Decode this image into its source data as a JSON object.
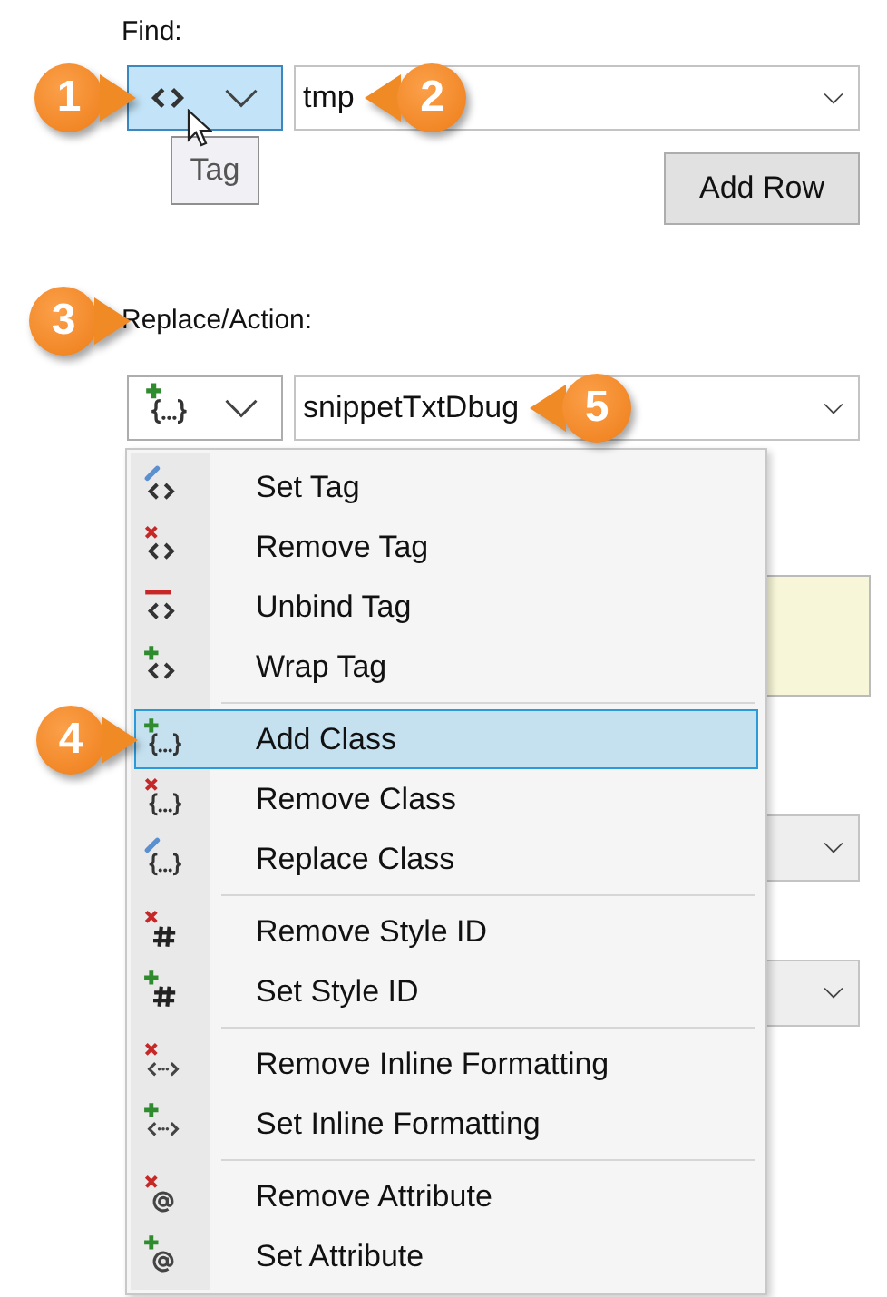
{
  "find": {
    "label": "Find:",
    "type_button": {
      "kind": "tag",
      "hovered": true,
      "tooltip": "Tag",
      "callout": {
        "number": "1",
        "points_left": false
      }
    },
    "value": "tmp",
    "value_callout": {
      "number": "2",
      "points_left": true
    }
  },
  "add_row_button": "Add Row",
  "replace": {
    "label": "Replace/Action:",
    "label_callout": {
      "number": "3",
      "points_left": false
    },
    "type_button": {
      "kind": "add-class",
      "hovered": false
    },
    "value": "snippetTxtDbug",
    "value_callout": {
      "number": "5",
      "points_left": true
    }
  },
  "background_fields": [
    {
      "kind": "textarea"
    },
    {
      "kind": "dropdown"
    },
    {
      "kind": "dropdown"
    }
  ],
  "menu": {
    "groups": [
      {
        "items": [
          {
            "label": "Set Tag",
            "kind": "set-tag",
            "selected": false
          },
          {
            "label": "Remove Tag",
            "kind": "remove-tag",
            "selected": false
          },
          {
            "label": "Unbind Tag",
            "kind": "unbind-tag",
            "selected": false
          },
          {
            "label": "Wrap Tag",
            "kind": "wrap-tag",
            "selected": false
          }
        ]
      },
      {
        "items": [
          {
            "label": "Add Class",
            "kind": "add-class",
            "selected": true,
            "callout": {
              "number": "4",
              "points_left": false
            }
          },
          {
            "label": "Remove Class",
            "kind": "remove-class",
            "selected": false
          },
          {
            "label": "Replace Class",
            "kind": "replace-class",
            "selected": false
          }
        ]
      },
      {
        "items": [
          {
            "label": "Remove Style ID",
            "kind": "remove-style-id",
            "selected": false
          },
          {
            "label": "Set Style ID",
            "kind": "set-style-id",
            "selected": false
          }
        ]
      },
      {
        "items": [
          {
            "label": "Remove Inline Formatting",
            "kind": "remove-inline-formatting",
            "selected": false
          },
          {
            "label": "Set Inline Formatting",
            "kind": "set-inline-formatting",
            "selected": false
          }
        ]
      },
      {
        "items": [
          {
            "label": "Remove Attribute",
            "kind": "remove-attribute",
            "selected": false
          },
          {
            "label": "Set Attribute",
            "kind": "set-attribute",
            "selected": false
          }
        ]
      }
    ]
  }
}
